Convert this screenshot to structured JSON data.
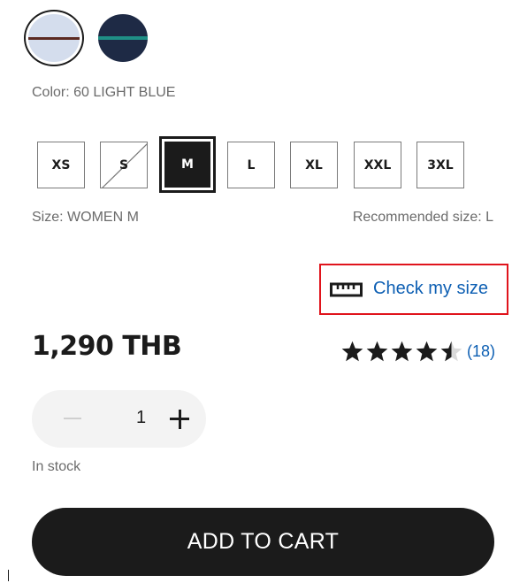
{
  "colors": {
    "swatches": [
      {
        "name": "light-blue",
        "selected": true,
        "fill": "#d4dded",
        "stripe": "#5b2a22"
      },
      {
        "name": "navy",
        "selected": false,
        "fill": "#1e2a45",
        "stripe": "#1f8f86"
      }
    ],
    "label": "Color: 60 LIGHT BLUE"
  },
  "sizes": {
    "options": [
      {
        "label": "XS",
        "state": "available"
      },
      {
        "label": "S",
        "state": "unavailable"
      },
      {
        "label": "M",
        "state": "selected"
      },
      {
        "label": "L",
        "state": "available"
      },
      {
        "label": "XL",
        "state": "available"
      },
      {
        "label": "XXL",
        "state": "available"
      },
      {
        "label": "3XL",
        "state": "available"
      }
    ],
    "label": "Size: WOMEN M",
    "recommended": "Recommended size: L"
  },
  "check_size": {
    "label": "Check my size",
    "icon": "ruler-icon",
    "highlight_color": "#e0141c"
  },
  "price": "1,290 THB",
  "rating": {
    "stars": 4.5,
    "max": 5,
    "count": "(18)"
  },
  "quantity": {
    "value": "1"
  },
  "stock": "In stock",
  "cta": {
    "label": "ADD TO CART"
  },
  "theme": {
    "text": "#1b1b1b",
    "muted": "#6b6b6b",
    "link": "#0d5fb3"
  }
}
